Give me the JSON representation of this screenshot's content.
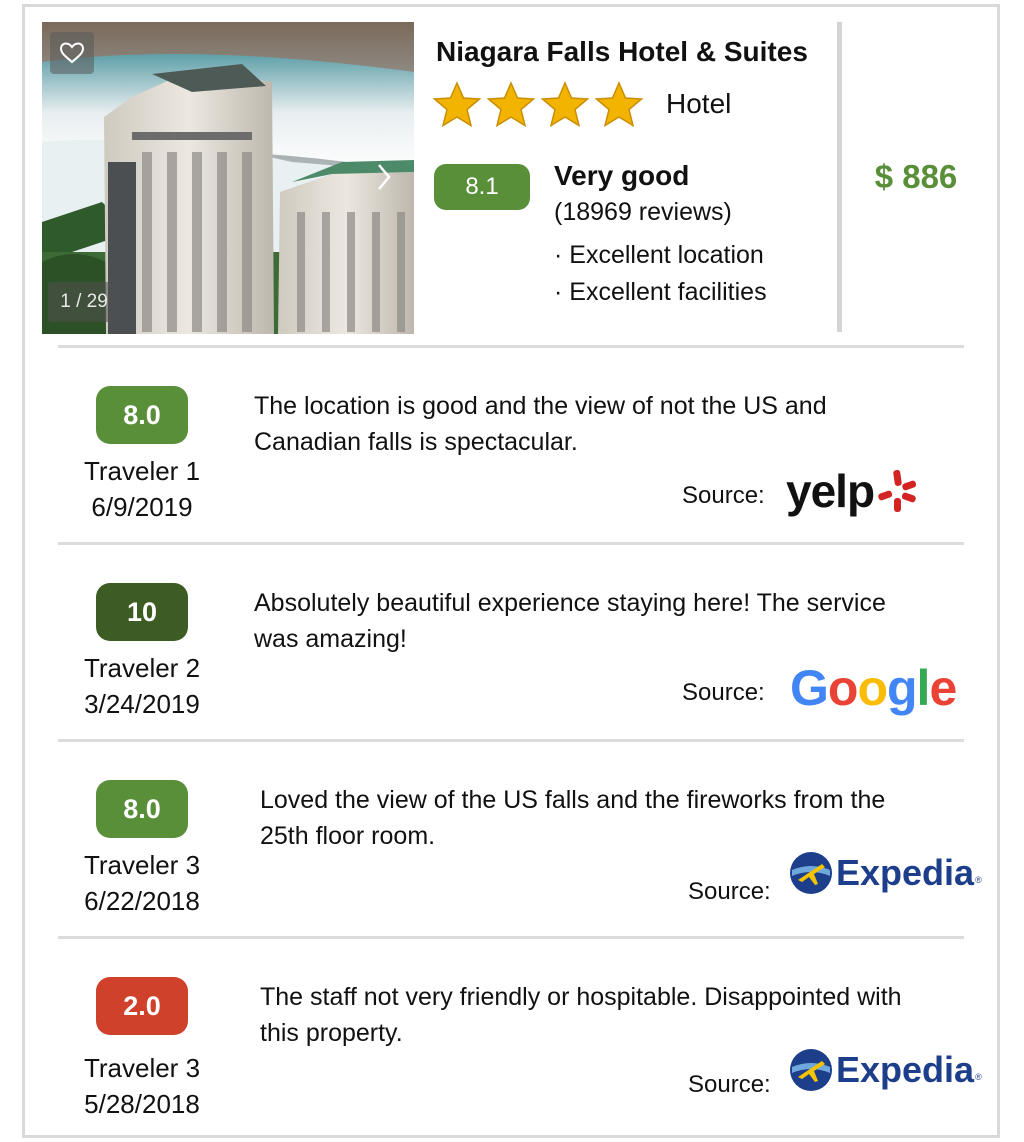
{
  "hotel": {
    "name": "Niagara Falls Hotel & Suites",
    "star_count": 4,
    "type": "Hotel",
    "score": "8.1",
    "rating_word": "Very good",
    "review_count": "(18969 reviews)",
    "highlights": [
      "· Excellent location",
      "· Excellent facilities"
    ],
    "price": "$ 886"
  },
  "gallery": {
    "counter": "1 / 29",
    "icons": [
      "heart-icon",
      "chevron-right-icon"
    ]
  },
  "colors": {
    "score_green": "#5a8f3a",
    "score_dark_green": "#3d5c24",
    "score_red": "#d0412c",
    "star_gold": "#f2b400",
    "expedia_blue": "#1d3e8a"
  },
  "reviews": [
    {
      "score": "8.0",
      "score_color": "#5a8f3a",
      "traveler": "Traveler 1",
      "date": "6/9/2019",
      "text": "The location is good and the view of not the US and Canadian falls is spectacular.",
      "source_label": "Source:",
      "source_logo": "yelp",
      "logo_text": "yelp"
    },
    {
      "score": "10",
      "score_color": "#3d5c24",
      "traveler": "Traveler 2",
      "date": "3/24/2019",
      "text": "Absolutely beautiful experience staying here! The service was amazing!",
      "source_label": "Source:",
      "source_logo": "google",
      "logo_text": "Google"
    },
    {
      "score": "8.0",
      "score_color": "#5a8f3a",
      "traveler": "Traveler 3",
      "date": "6/22/2018",
      "text": "Loved the view of the US falls and the fireworks from the 25th floor room.",
      "source_label": "Source:",
      "source_logo": "expedia",
      "logo_text": "Expedia"
    },
    {
      "score": "2.0",
      "score_color": "#d0412c",
      "traveler": "Traveler 3",
      "date": "5/28/2018",
      "text": "The staff not very friendly or hospitable. Disappointed with this property.",
      "source_label": "Source:",
      "source_logo": "expedia",
      "logo_text": "Expedia"
    }
  ]
}
